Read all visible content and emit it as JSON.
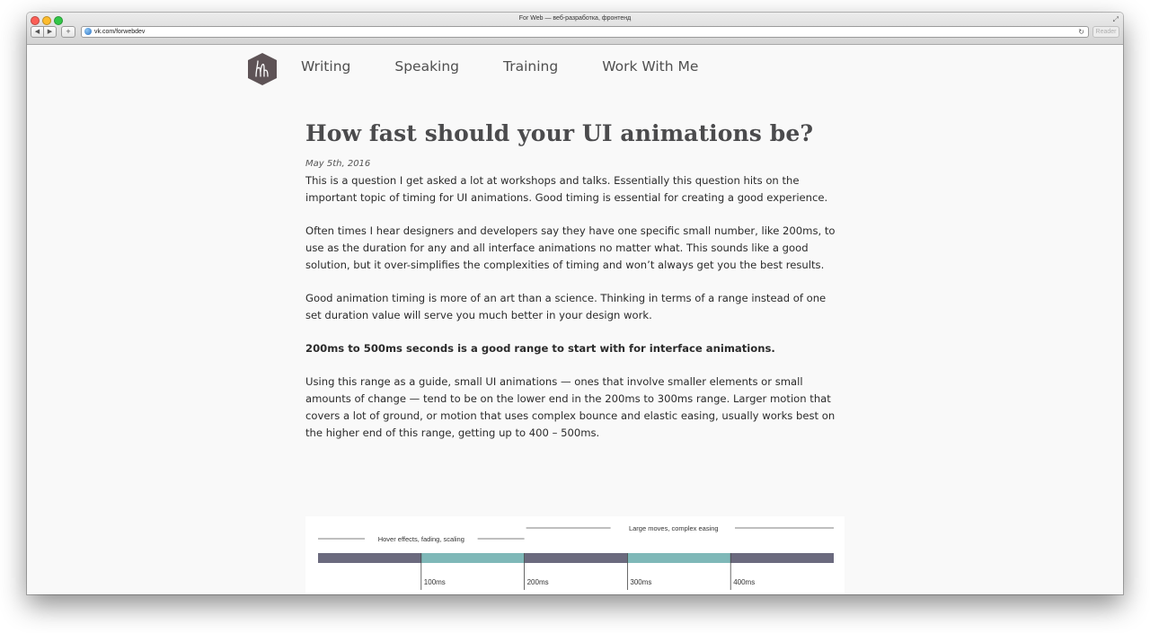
{
  "browser": {
    "window_title": "For Web — веб-разработка, фронтенд",
    "url": "vk.com/forwebdev",
    "back_label": "◀",
    "forward_label": "▶",
    "add_label": "+",
    "reader_label": "Reader"
  },
  "nav": {
    "items": [
      "Writing",
      "Speaking",
      "Training",
      "Work With Me"
    ]
  },
  "article": {
    "title": "How fast should your UI animations be?",
    "date": "May 5th, 2016",
    "paragraphs": [
      "This is a question I get asked a lot at workshops and talks. Essentially this question hits on the important topic of timing for UI animations. Good timing is essential for creating a good experience.",
      "Often times I hear designers and developers say they have one specific small number, like 200ms, to use as the duration for any and all interface animations no matter what. This sounds like a good solution, but it over-simplifies the complexities of timing and won’t always get you the best results.",
      "Good animation timing is more of an art than a science. Thinking in terms of a range instead of one set duration value will serve you much better in your design work.",
      "200ms to 500ms seconds is a good range to start with for interface animations.",
      "Using this range as a guide, small UI animations — ones that involve smaller elements or small amounts of change — tend to be on the lower end in the 200ms to 300ms range. Larger motion that covers a lot of ground, or motion that uses complex bounce and elastic easing, usually works best on the higher end of this range, getting up to 400 – 500ms."
    ]
  },
  "diagram": {
    "range_small_label": "Hover effects, fading, scaling",
    "range_large_label": "Large moves, complex easing",
    "tick_labels": [
      "100ms",
      "200ms",
      "300ms",
      "400ms"
    ],
    "segments": [
      {
        "from": 0,
        "to": 100,
        "color": "#6b6a7e"
      },
      {
        "from": 100,
        "to": 200,
        "color": "#7fb8b8"
      },
      {
        "from": 200,
        "to": 300,
        "color": "#6b6a7e"
      },
      {
        "from": 300,
        "to": 400,
        "color": "#7fb8b8"
      },
      {
        "from": 400,
        "to": 500,
        "color": "#6b6a7e"
      }
    ]
  },
  "colors": {
    "logo": "#5e5356",
    "heading": "#4b4b4d"
  }
}
